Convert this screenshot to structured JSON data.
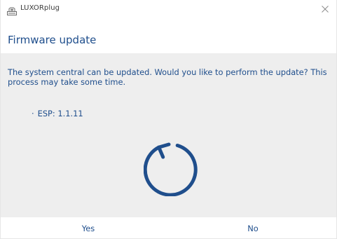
{
  "window": {
    "title": "LUXORplug",
    "app_icon": "luxor-logo-icon",
    "close_icon": "close-icon"
  },
  "dialog": {
    "heading": "Firmware update",
    "message": "The system central can be updated. Would you like to perform the update? This process may take some time.",
    "component_bullet": "·",
    "component": "ESP: 1.1.11",
    "progress_icon": "refresh-icon"
  },
  "buttons": {
    "yes_label": "Yes",
    "no_label": "No"
  },
  "colors": {
    "accent": "#1f4e8c",
    "content_bg": "#eeeeee",
    "window_bg": "#ffffff"
  }
}
